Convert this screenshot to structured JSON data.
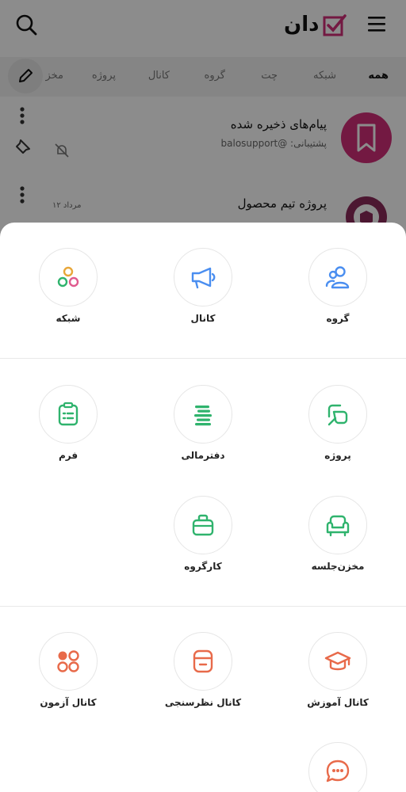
{
  "colors": {
    "blue": "#4a8ef0",
    "green": "#2fb36d",
    "orange": "#e86a4a",
    "brand": "#d12e78",
    "overlay": "rgba(0,0,0,0.45)"
  },
  "header": {
    "logo_text": "دان",
    "search_icon": "search-icon",
    "menu_icon": "hamburger-icon"
  },
  "tabs": [
    {
      "label": "همه",
      "active": true
    },
    {
      "label": "شبکه"
    },
    {
      "label": "چت"
    },
    {
      "label": "گروه"
    },
    {
      "label": "کانال"
    },
    {
      "label": "پروژه"
    },
    {
      "label": "مخز"
    }
  ],
  "chats": [
    {
      "title": "پیام‌های ذخیره شده",
      "subtitle": "پشتیبانی: @balosupport",
      "icon": "bookmark-icon"
    },
    {
      "title": "پروژه تیم محصول",
      "date": "۱۲ مرداد",
      "icon": "gear-box-icon"
    }
  ],
  "sheet": {
    "section1": [
      {
        "label": "گروه",
        "icon": "group-icon",
        "color": "blue"
      },
      {
        "label": "کانال",
        "icon": "megaphone-icon",
        "color": "blue"
      },
      {
        "label": "شبکه",
        "icon": "network-icon",
        "color": "multi"
      }
    ],
    "section2": [
      {
        "label": "پروژه",
        "icon": "project-icon",
        "color": "green"
      },
      {
        "label": "دفترمالی",
        "icon": "ledger-icon",
        "color": "green"
      },
      {
        "label": "فرم",
        "icon": "form-icon",
        "color": "green"
      },
      {
        "label": "مخزن‌جلسه",
        "icon": "armchair-icon",
        "color": "green"
      },
      {
        "label": "کارگروه",
        "icon": "briefcase-icon",
        "color": "green"
      }
    ],
    "section3": [
      {
        "label": "کانال آموزش",
        "icon": "graduation-cap-icon",
        "color": "orange"
      },
      {
        "label": "کانال نظرسنجی",
        "icon": "poll-box-icon",
        "color": "orange"
      },
      {
        "label": "کانال آزمون",
        "icon": "quiz-dots-icon",
        "color": "orange"
      },
      {
        "label": "",
        "icon": "chat-bubble-icon",
        "color": "orange"
      }
    ]
  }
}
